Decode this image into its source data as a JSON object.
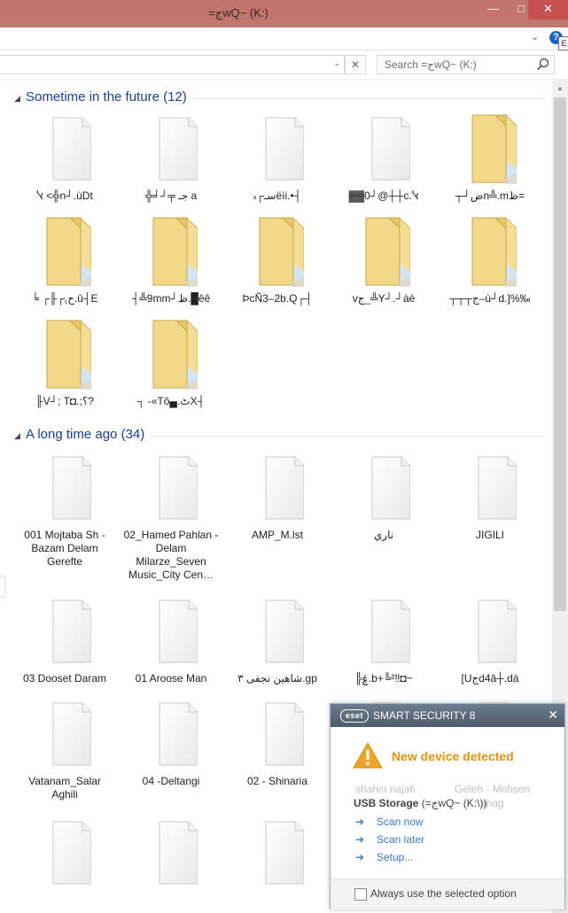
{
  "window": {
    "title": "=جwQ~ (K:)",
    "controls": {
      "minimize": "—",
      "maximize": "□",
      "close": "✕"
    },
    "help_label": "?",
    "tooltip_letter": "E"
  },
  "address_bar": {
    "search_placeholder": "Search =جwQ~ (K:)",
    "dropdown_glyph": "⌄",
    "refresh_glyph": "✕"
  },
  "groups": [
    {
      "label": "Sometime in the future (12)",
      "collapse_glyph": "◢",
      "items": [
        {
          "name": "ﭏ <╬n┘.ùDt",
          "icon": "file-icon"
        },
        {
          "name": "╬╛┘╤ جـ a",
          "icon": "file-icon"
        },
        {
          "name": "سـ┌ﮦëìi.•┤",
          "icon": "file-icon"
        },
        {
          "name": "▓▓0┘@┼┼c.ﭏ",
          "icon": "file-icon"
        },
        {
          "name": "┬┘ضn╩.mظ=",
          "icon": "folder-icon"
        },
        {
          "name": "╘ ┌╟┌ﺡﮨ.û┤E",
          "icon": "folder-icon"
        },
        {
          "name": "┤╩9mm┘ظ.█êê",
          "icon": "folder-icon"
        },
        {
          "name": "ÞcÑ3–2b.Q┌┤",
          "icon": "folder-icon"
        },
        {
          "name": "vج_╩Y┘.┘àè",
          "icon": "folder-icon"
        },
        {
          "name": "┬┬┬ج–ù┘d.]%‰",
          "icon": "folder-icon"
        },
        {
          "name": "╟V┘; T◘.;؟?",
          "icon": "folder-icon"
        },
        {
          "name": "┐ -«Tô▄.ٹX┤",
          "icon": "folder-icon"
        }
      ]
    },
    {
      "label": "A long time ago (34)",
      "collapse_glyph": "◢",
      "items": [
        {
          "name": "001 Mojtaba Sh - Bazam Delam Gerefte",
          "icon": "file-icon"
        },
        {
          "name": "02_Hamed Pahlan - Delam Milarze_Seven Music_City Cen…",
          "icon": "file-icon"
        },
        {
          "name": "AMP_M.lst",
          "icon": "file-icon"
        },
        {
          "name": "ناري",
          "icon": "file-icon"
        },
        {
          "name": "JIGILI",
          "icon": "file-icon"
        },
        {
          "name": "03 Dooset Daram",
          "icon": "file-icon"
        },
        {
          "name": "01 Aroose Man",
          "icon": "file-icon"
        },
        {
          "name": "شاهین نجفی ۳.gp",
          "icon": "file-icon"
        },
        {
          "name": "╠ۼ.b+╚²‼◘~",
          "icon": "file-icon"
        },
        {
          "name": "[Uجd4â┼.dà",
          "icon": "file-icon"
        },
        {
          "name": "Vatanam_Salar Aghili",
          "icon": "file-icon"
        },
        {
          "name": "04 -Deltangi",
          "icon": "file-icon"
        },
        {
          "name": "02 - Shinaria",
          "icon": "file-icon"
        },
        {
          "name": "shahin najafi",
          "icon": "file-icon"
        },
        {
          "name": "Geleh - Mohsen Chavoshi - Ahang",
          "icon": "file-icon"
        },
        {
          "name": "",
          "icon": "file-icon"
        },
        {
          "name": "",
          "icon": "file-icon"
        },
        {
          "name": "",
          "icon": "file-icon"
        },
        {
          "name": "",
          "icon": "file-icon"
        },
        {
          "name": "",
          "icon": "file-icon"
        }
      ]
    }
  ],
  "eset_popup": {
    "brand": "eset",
    "product": "SMART SECURITY 8",
    "close_glyph": "✕",
    "event_title": "New device detected",
    "ghost_left": "shahin najafi",
    "ghost_right": "Geleh - Mohsen",
    "ghost_right2": "ahag",
    "device_label": "USB Storage",
    "device_path": " (=جwQ~ (K:\\))",
    "actions": [
      {
        "label": "Scan now"
      },
      {
        "label": "Scan later"
      },
      {
        "label": "Setup..."
      }
    ],
    "action_arrow": "➔",
    "checkbox_label": "Always use the selected option"
  },
  "colors": {
    "titlebar": "#c0766f",
    "close_button": "#c75050",
    "group_header": "#1e3f8f",
    "eset_header": "#5a6979",
    "eset_warning": "#e8920c",
    "eset_link": "#3a78c8"
  }
}
